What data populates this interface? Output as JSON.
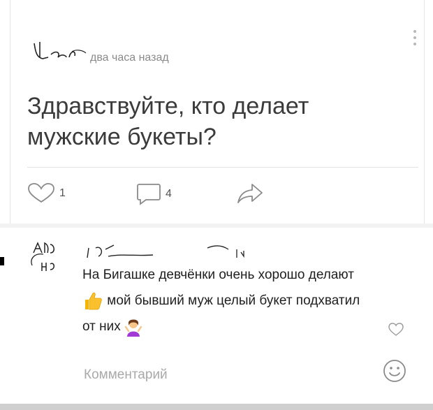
{
  "post": {
    "time": "два часа назад",
    "text": "Здравствуйте, кто делает\nмужские букеты?",
    "likes": "1",
    "comments": "4"
  },
  "comment": {
    "text_part1": "На Бигашке девчёнки очень хорошо делают",
    "text_part2": " мой бывший муж целый букет подхватил от них"
  },
  "composer": {
    "placeholder": "Комментарий"
  },
  "icons": {
    "like": "heart-icon",
    "comment": "comment-icon",
    "share": "share-icon",
    "menu": "more-vertical-icon",
    "emoji": "smile-icon",
    "thumbs": "thumbs-up-emoji",
    "shrug": "shrug-emoji"
  },
  "colors": {
    "icon": "#8a8a8a",
    "text": "#3b3b3b"
  }
}
